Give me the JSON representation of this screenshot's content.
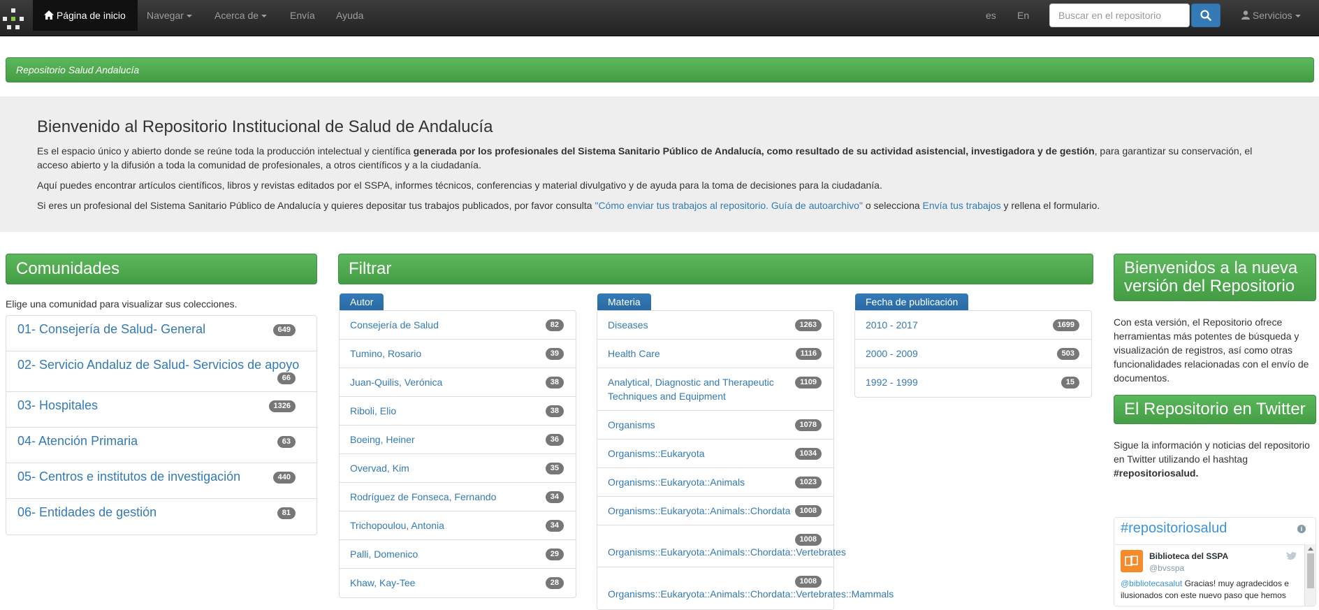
{
  "navbar": {
    "home_label": "Página de inicio",
    "browse_label": "Navegar",
    "about_label": "Acerca de",
    "submit_label": "Envía",
    "help_label": "Ayuda",
    "lang_es": "es",
    "lang_en": "En",
    "search_placeholder": "Buscar en el repositorio",
    "services_label": "Servicios"
  },
  "breadcrumb": {
    "label": "Repositorio Salud Andalucía"
  },
  "welcome": {
    "title": "Bienvenido al Repositorio Institucional de Salud de Andalucía",
    "p1_a": "Es el espacio único y abierto donde se reúne toda la producción intelectual y científica ",
    "p1_bold": "generada por los profesionales del Sistema Sanitario Público de Andalucía, como resultado de su actividad asistencial, investigadora y de gestión",
    "p1_b": ", para garantizar su conservación, el acceso abierto y la difusión a toda la comunidad de profesionales, a otros científicos y a la ciudadanía.",
    "p2": "Aquí puedes encontrar artículos científicos, libros y revistas editados por el SSPA, informes técnicos, conferencias y material divulgativo y de ayuda para la toma de decisiones para la ciudadanía.",
    "p3_a": "Si eres un profesional del Sistema Sanitario Público de Andalucía y quieres depositar tus trabajos publicados, por favor consulta ",
    "p3_link1": "\"Cómo enviar tus trabajos al repositorio. Guía de autoarchivo\"",
    "p3_b": " o selecciona ",
    "p3_link2": "Envía tus trabajos",
    "p3_c": " y rellena el formulario."
  },
  "communities": {
    "title": "Comunidades",
    "intro": "Elige una comunidad para visualizar sus colecciones.",
    "items": [
      {
        "label": "01- Consejería de Salud- General",
        "count": "649"
      },
      {
        "label": "02- Servicio Andaluz de Salud- Servicios de apoyo",
        "count": "66"
      },
      {
        "label": "03- Hospitales",
        "count": "1326"
      },
      {
        "label": "04- Atención Primaria",
        "count": "63"
      },
      {
        "label": "05- Centros e institutos de investigación",
        "count": "440"
      },
      {
        "label": "06- Entidades de gestión",
        "count": "81"
      }
    ]
  },
  "filter": {
    "title": "Filtrar",
    "author": {
      "tab": "Autor",
      "items": [
        {
          "label": "Consejería de Salud",
          "count": "82"
        },
        {
          "label": "Tumino, Rosario",
          "count": "39"
        },
        {
          "label": "Juan-Quilis, Verónica",
          "count": "38"
        },
        {
          "label": "Riboli, Elio",
          "count": "38"
        },
        {
          "label": "Boeing, Heiner",
          "count": "36"
        },
        {
          "label": "Overvad, Kim",
          "count": "35"
        },
        {
          "label": "Rodríguez de Fonseca, Fernando",
          "count": "34"
        },
        {
          "label": "Trichopoulou, Antonia",
          "count": "34"
        },
        {
          "label": "Palli, Domenico",
          "count": "29"
        },
        {
          "label": "Khaw, Kay-Tee",
          "count": "28"
        }
      ]
    },
    "subject": {
      "tab": "Materia",
      "items": [
        {
          "label": "Diseases",
          "count": "1263"
        },
        {
          "label": "Health Care",
          "count": "1116"
        },
        {
          "label": "Analytical, Diagnostic and Therapeutic Techniques and Equipment",
          "count": "1109"
        },
        {
          "label": "Organisms",
          "count": "1078"
        },
        {
          "label": "Organisms::Eukaryota",
          "count": "1034"
        },
        {
          "label": "Organisms::Eukaryota::Animals",
          "count": "1023"
        },
        {
          "label": "Organisms::Eukaryota::Animals::Chordata",
          "count": "1008"
        },
        {
          "label": "Organisms::Eukaryota::Animals::Chordata::Vertebrates",
          "count": "1008"
        },
        {
          "label": "Organisms::Eukaryota::Animals::Chordata::Vertebrates::Mammals",
          "count": "1008"
        }
      ]
    },
    "date": {
      "tab": "Fecha de publicación",
      "items": [
        {
          "label": "2010 - 2017",
          "count": "1699"
        },
        {
          "label": "2000 - 2009",
          "count": "503"
        },
        {
          "label": "1992 - 1999",
          "count": "15"
        }
      ]
    }
  },
  "news": {
    "title": "Bienvenidos a la nueva versión del Repositorio",
    "text": "Con esta versión, el Repositorio ofrece herramientas más potentes de búsqueda y visualización de registros, así como otras funcionalidades relacionadas con el envío de documentos."
  },
  "twitter": {
    "title": "El Repositorio en Twitter",
    "text": "Sigue la información y noticias del repositorio en Twitter utilizando el hashtag ",
    "hashtag_bold": "#repositoriosalud.",
    "widget_title": "#repositoriosalud",
    "tweet_name": "Biblioteca del SSPA",
    "tweet_handle": "@bvsspa",
    "tweet_mention": "@bibliotecasalut",
    "tweet_text": " Gracias! muy agradecidos e ilusionados con este nuevo paso que hemos"
  },
  "colors": {
    "panel_green": "#5cb85c",
    "tab_blue": "#337ab7",
    "navbar": "#222222",
    "badge": "#777777"
  }
}
